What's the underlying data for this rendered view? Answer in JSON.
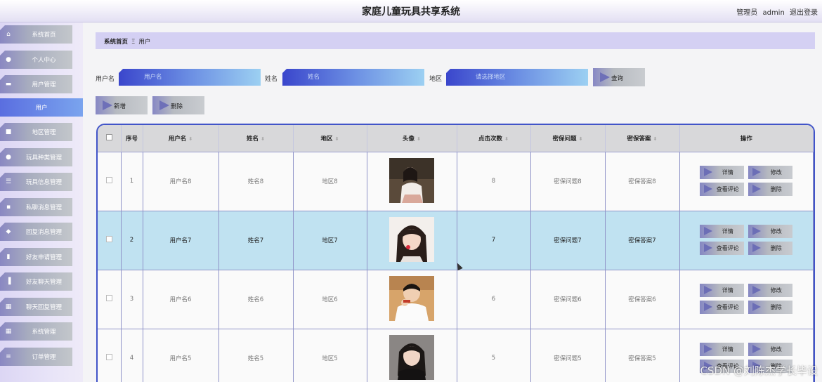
{
  "header": {
    "title": "家庭儿童玩具共享系统",
    "role": "管理员",
    "username": "admin",
    "logout": "退出登录"
  },
  "sidebar": {
    "items": [
      {
        "label": "系统首页",
        "icon": "home-icon"
      },
      {
        "label": "个人中心",
        "icon": "person-icon"
      },
      {
        "label": "用户管理",
        "icon": "briefcase-icon"
      },
      {
        "label": "用户",
        "icon": "",
        "active": true
      },
      {
        "label": "地区管理",
        "icon": "clipboard-icon"
      },
      {
        "label": "玩具种类管理",
        "icon": "person-icon"
      },
      {
        "label": "玩具信息管理",
        "icon": "list-icon"
      },
      {
        "label": "私聊消息管理",
        "icon": "chat-icon"
      },
      {
        "label": "回复消息管理",
        "icon": "location-icon"
      },
      {
        "label": "好友申请管理",
        "icon": "book-icon"
      },
      {
        "label": "好友聊天管理",
        "icon": "bar-chart-icon"
      },
      {
        "label": "聊天回复管理",
        "icon": "grid-icon"
      },
      {
        "label": "系统管理",
        "icon": "grid-icon"
      },
      {
        "label": "订单管理",
        "icon": "menu-icon"
      }
    ]
  },
  "breadcrumb": {
    "home": "系统首页",
    "separator": "Ξ",
    "current": "用户"
  },
  "search": {
    "username_label": "用户名",
    "username_placeholder": "用户名",
    "name_label": "姓名",
    "name_placeholder": "姓名",
    "region_label": "地区",
    "region_placeholder": "请选择地区",
    "query_button": "查询"
  },
  "actions": {
    "add": "新增",
    "delete": "删除"
  },
  "table": {
    "columns": [
      "序号",
      "用户名",
      "姓名",
      "地区",
      "头像",
      "点击次数",
      "密保问题",
      "密保答案",
      "操作"
    ],
    "rows": [
      {
        "index": "1",
        "username": "用户名8",
        "name": "姓名8",
        "region": "地区8",
        "clicks": "8",
        "question": "密保问题8",
        "answer": "密保答案8"
      },
      {
        "index": "2",
        "username": "用户名7",
        "name": "姓名7",
        "region": "地区7",
        "clicks": "7",
        "question": "密保问题7",
        "answer": "密保答案7",
        "selected": true
      },
      {
        "index": "3",
        "username": "用户名6",
        "name": "姓名6",
        "region": "地区6",
        "clicks": "6",
        "question": "密保问题6",
        "answer": "密保答案6"
      },
      {
        "index": "4",
        "username": "用户名5",
        "name": "姓名5",
        "region": "地区5",
        "clicks": "5",
        "question": "密保问题5",
        "answer": "密保答案5"
      }
    ],
    "row_actions": {
      "detail": "详情",
      "edit": "修改",
      "comments": "查看评论",
      "delete": "删除"
    }
  },
  "watermark": "CSDN @刘陈杰学长毕设",
  "colors": {
    "accent": "#4154c8",
    "breadcrumb_bg": "#d4d0f3",
    "selected_row": "#c0e2f1"
  }
}
